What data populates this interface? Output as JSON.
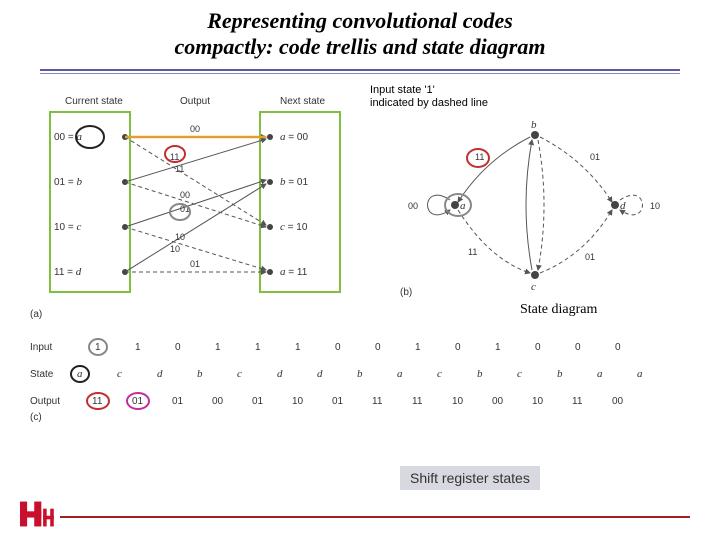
{
  "title_line1": "Representing convolutional codes",
  "title_line2": "compactly: code trellis and state diagram",
  "note_line1": "Input state '1'",
  "note_line2": "indicated by dashed line",
  "state_diagram_label": "State diagram",
  "shift_label": "Shift register states",
  "trellis": {
    "headers": {
      "current": "Current state",
      "output": "Output",
      "next": "Next state"
    },
    "states": [
      {
        "bits": "00",
        "name": "a"
      },
      {
        "bits": "01",
        "name": "b"
      },
      {
        "bits": "10",
        "name": "c"
      },
      {
        "bits": "11",
        "name": "d"
      }
    ],
    "next_states": [
      {
        "name": "a",
        "bits": "00"
      },
      {
        "name": "b",
        "bits": "01"
      },
      {
        "name": "c",
        "bits": "10"
      },
      {
        "name": "a",
        "bits": "11"
      }
    ],
    "outputs": [
      "00",
      "11",
      "11",
      "00",
      "01",
      "10",
      "10",
      "01"
    ],
    "tag_a": "(a)"
  },
  "statedia": {
    "nodes": {
      "a": "a",
      "b": "b",
      "c": "c",
      "d": "d"
    },
    "labels": {
      "a_left": "00",
      "b_top": "11",
      "d_right": "10",
      "t_01": "01",
      "t_10": "10",
      "t_11": "11",
      "t_00": "00"
    },
    "tag_b": "(b)"
  },
  "sequence": {
    "row_labels": {
      "input": "Input",
      "state": "State",
      "output": "Output"
    },
    "inputs": [
      "1",
      "1",
      "0",
      "1",
      "1",
      "1",
      "0",
      "0",
      "1",
      "0",
      "1",
      "0",
      "0",
      "0"
    ],
    "states": [
      "a",
      "c",
      "d",
      "b",
      "c",
      "d",
      "d",
      "b",
      "a",
      "c",
      "b",
      "c",
      "b",
      "a",
      "a"
    ],
    "outputs": [
      "11",
      "01",
      "01",
      "00",
      "01",
      "10",
      "01",
      "11",
      "11",
      "10",
      "00",
      "10",
      "11",
      "00"
    ],
    "tag_c": "(c)"
  }
}
